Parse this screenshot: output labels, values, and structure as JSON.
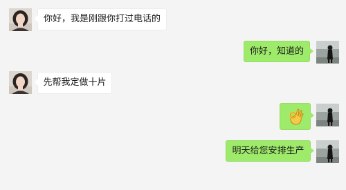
{
  "messages": [
    {
      "sender": "contact",
      "text": "你好，我是刚跟你打过电话的"
    },
    {
      "sender": "me",
      "text": "你好，知道的"
    },
    {
      "sender": "contact",
      "text": "先帮我定做十片"
    },
    {
      "sender": "me",
      "emoji": "ok-hand-icon"
    },
    {
      "sender": "me",
      "text": "明天给您安排生产"
    }
  ],
  "colors": {
    "chat_background": "#f4f4f4",
    "incoming_bubble": "#ffffff",
    "outgoing_bubble": "#9eea6a"
  }
}
